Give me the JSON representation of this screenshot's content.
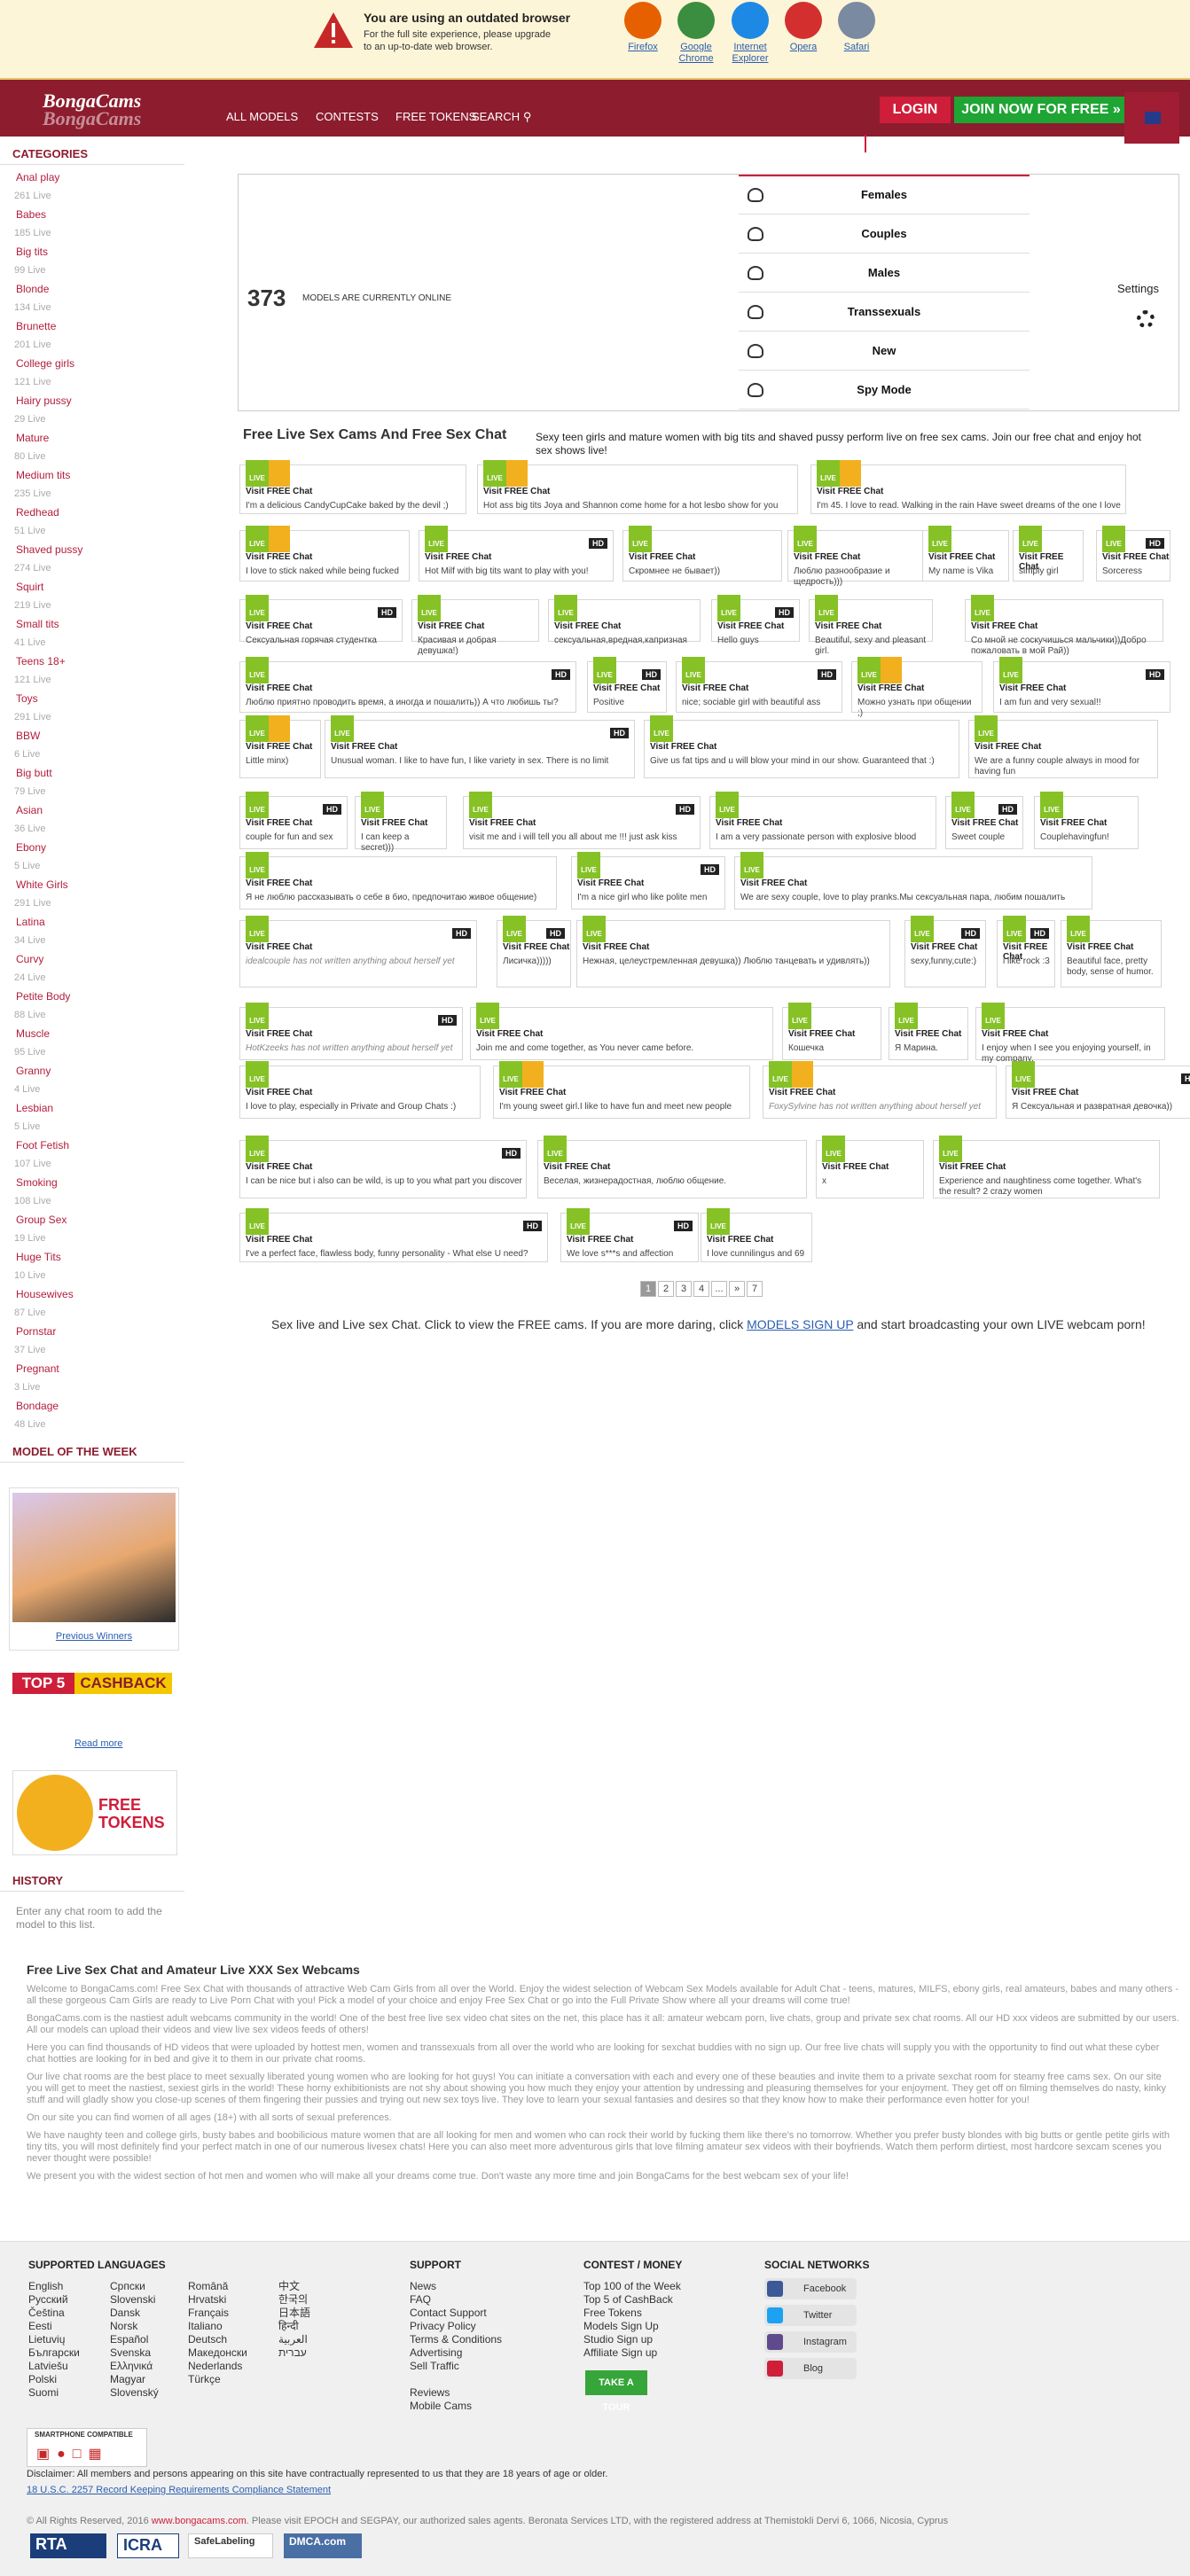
{
  "outdated": {
    "title": "You are using an outdated browser",
    "text": "For the full site experience, please upgrade to an up-to-date web browser.",
    "browsers": [
      {
        "label": "Firefox",
        "icon": "firefox-icon",
        "color": "#e66000"
      },
      {
        "label": "Google Chrome",
        "icon": "chrome-icon",
        "color": "#3b8d3f"
      },
      {
        "label": "Internet Explorer",
        "icon": "ie-icon",
        "color": "#1e88e5"
      },
      {
        "label": "Opera",
        "icon": "opera-icon",
        "color": "#d32f2f"
      },
      {
        "label": "Safari",
        "icon": "safari-icon",
        "color": "#7a8aa0"
      }
    ]
  },
  "header": {
    "logo": "BongaCams",
    "nav": [
      "ALL MODELS",
      "CONTESTS",
      "FREE TOKENS"
    ],
    "search": "SEARCH",
    "login": "LOGIN",
    "join": "JOIN NOW FOR FREE »",
    "brand": "#8c1c2e"
  },
  "sidebar": {
    "categories_title": "CATEGORIES",
    "categories": [
      [
        "Anal play",
        "261 Live"
      ],
      [
        "Babes",
        "185 Live"
      ],
      [
        "Big tits",
        "99 Live"
      ],
      [
        "Blonde",
        "134 Live"
      ],
      [
        "Brunette",
        "201 Live"
      ],
      [
        "College girls",
        "121 Live"
      ],
      [
        "Hairy pussy",
        "29 Live"
      ],
      [
        "Mature",
        "80 Live"
      ],
      [
        "Medium tits",
        "235 Live"
      ],
      [
        "Redhead",
        "51 Live"
      ],
      [
        "Shaved pussy",
        "274 Live"
      ],
      [
        "Squirt",
        "219 Live"
      ],
      [
        "Small tits",
        "41 Live"
      ],
      [
        "Teens 18+",
        "121 Live"
      ],
      [
        "Toys",
        "291 Live"
      ],
      [
        "BBW",
        "6 Live"
      ],
      [
        "Big butt",
        "79 Live"
      ],
      [
        "Asian",
        "36 Live"
      ],
      [
        "Ebony",
        "5 Live"
      ],
      [
        "White Girls",
        "291 Live"
      ],
      [
        "Latina",
        "34 Live"
      ],
      [
        "Curvy",
        "24 Live"
      ],
      [
        "Petite Body",
        "88 Live"
      ],
      [
        "Muscle",
        "95 Live"
      ],
      [
        "Granny",
        "4 Live"
      ],
      [
        "Lesbian",
        "5 Live"
      ],
      [
        "Foot Fetish",
        "107 Live"
      ],
      [
        "Smoking",
        "108 Live"
      ],
      [
        "Group Sex",
        "19 Live"
      ],
      [
        "Huge Tits",
        "10 Live"
      ],
      [
        "Housewives",
        "87 Live"
      ],
      [
        "Pornstar",
        "37 Live"
      ],
      [
        "Pregnant",
        "3 Live"
      ],
      [
        "Bondage",
        "48 Live"
      ]
    ],
    "motw_title": "MODEL OF THE WEEK",
    "previous_winners": "Previous Winners",
    "top5": "TOP 5",
    "cashback": "CASHBACK",
    "read_more": "Read more",
    "free_tokens": "FREE TOKENS",
    "history_title": "HISTORY",
    "history_text": "Enter any chat room to add the model to this list."
  },
  "stats": {
    "count": "373",
    "caption": "MODELS ARE CURRENTLY ONLINE",
    "genders": [
      "Females",
      "Couples",
      "Males",
      "Transsexuals",
      "New",
      "Spy Mode"
    ],
    "settings": "Settings"
  },
  "main": {
    "title": "Free Live Sex Cams And Free Sex Chat",
    "intro": "Sexy teen girls and mature women with big tits and shaved pussy perform live on free sex cams. Join our free chat and enjoy hot sex shows live!",
    "live": "LIVE",
    "visit": "Visit FREE Chat",
    "hd": "HD",
    "cards": [
      [
        "I'm a delicious CandyCupCake baked by the devil ;)",
        0,
        1,
        0
      ],
      [
        "Hot ass big tits Joya and Shannon come home for a hot lesbo show for you",
        0,
        1,
        0
      ],
      [
        "I'm 45. I love to read. Walking in the rain Have sweet dreams of the one I love",
        0,
        1,
        0
      ],
      [
        "I love to stick naked while being fucked",
        0,
        1,
        0
      ],
      [
        "Hot Milf with big tits want to play with you!",
        1,
        0,
        0
      ],
      [
        "Скромнее не бывает))",
        0,
        0,
        0
      ],
      [
        "Люблю разнообразие и щедрость)))",
        0,
        0,
        0
      ],
      [
        "My name is Vika",
        0,
        0,
        0
      ],
      [
        "simply girl",
        0,
        0,
        0
      ],
      [
        "Sorceress",
        1,
        0,
        0
      ],
      [
        "Сексуальная горячая студентка",
        1,
        0,
        0
      ],
      [
        "Красивая и добрая девушка!)",
        0,
        0,
        0
      ],
      [
        "сексуальная,вредная,капризная",
        0,
        0,
        0
      ],
      [
        "Hello guys",
        1,
        0,
        0
      ],
      [
        "Beautiful, sexy and pleasant girl.",
        0,
        0,
        0
      ],
      [
        "Со мной не соскучишься мальчики))Добро пожаловать в мой Рай))",
        0,
        0,
        0
      ],
      [
        "Люблю приятно проводить время, а иногда и пошалить)) А что любишь ты?",
        1,
        0,
        0
      ],
      [
        "Positive",
        1,
        0,
        0
      ],
      [
        "nice; sociable girl with beautiful ass",
        1,
        0,
        0
      ],
      [
        "Можно узнать при общении ;)",
        0,
        1,
        0
      ],
      [
        "I am fun and very sexual!!",
        1,
        0,
        0
      ],
      [
        "Little minx)",
        0,
        1,
        0
      ],
      [
        "Unusual woman. I like to have fun, I like variety in sex. There is no limit",
        1,
        0,
        0
      ],
      [
        "Give us fat tips and u will blow your mind in our show. Guaranteed that :)",
        0,
        0,
        0
      ],
      [
        "We are a funny couple always in mood for having fun",
        0,
        0,
        0
      ],
      [
        "couple for fun and sex",
        1,
        0,
        0
      ],
      [
        "I can keep a secret)))",
        0,
        0,
        0
      ],
      [
        "visit me and i will tell you all about me !!! just ask kiss",
        1,
        0,
        0
      ],
      [
        "I am a very passionate person with explosive blood",
        0,
        0,
        0
      ],
      [
        "Sweet couple",
        1,
        0,
        0
      ],
      [
        "Couplehavingfun!",
        0,
        0,
        0
      ],
      [
        "Я не люблю рассказывать о себе в био, предпочитаю живое общение)",
        0,
        0,
        0
      ],
      [
        "I'm a nice girl who like polite men",
        1,
        0,
        0
      ],
      [
        "We are sexy couple, love to play pranks.Мы сексуальная пара, любим пошалить",
        0,
        0,
        0
      ],
      [
        "idealcouple has not written anything about herself yet",
        1,
        0,
        1
      ],
      [
        "Лисичка)))))",
        1,
        0,
        0
      ],
      [
        "Нежная, целеустремленная девушка)) Люблю танцевать и удивлять))",
        0,
        0,
        0
      ],
      [
        "sexy,funny,cute:)",
        1,
        0,
        0
      ],
      [
        "i like rock :3",
        1,
        0,
        0
      ],
      [
        "Beautiful face, pretty body, sense of humor.",
        0,
        0,
        0
      ],
      [
        "HotKzeeks has not written anything about herself yet",
        1,
        0,
        1
      ],
      [
        "Join me and come together, as You never came before.",
        0,
        0,
        0
      ],
      [
        "Кошечка",
        0,
        0,
        0
      ],
      [
        "Я Марина.",
        0,
        0,
        0
      ],
      [
        "I enjoy when I see you enjoying yourself, in my company.",
        0,
        0,
        0
      ],
      [
        "I love to play, especially in Private and Group Chats :)",
        0,
        0,
        0
      ],
      [
        "I'm young sweet girl.I like to have fun and meet new people",
        0,
        1,
        0
      ],
      [
        "FoxySylvine has not written anything about herself yet",
        0,
        1,
        1
      ],
      [
        "Я Сексуальная и развратная девочка))",
        1,
        0,
        0
      ],
      [
        "I can be nice but i also can be wild, is up to you what part you discover",
        1,
        0,
        0
      ],
      [
        "Веселая, жизнерадостная, люблю общение.",
        0,
        0,
        0
      ],
      [
        "x",
        0,
        0,
        0
      ],
      [
        "Experience and naughtiness come together. What's the result? 2 crazy women",
        0,
        0,
        0
      ],
      [
        "I've a perfect face, flawless body, funny personality - What else U need?",
        1,
        0,
        0
      ],
      [
        "We love s***s and affection",
        1,
        0,
        0
      ],
      [
        "I love cunnilingus and 69",
        0,
        0,
        0
      ]
    ],
    "pages": [
      "1",
      "2",
      "3",
      "4",
      "...",
      "»",
      "7"
    ],
    "cta_pre": "Sex live and Live sex Chat. Click to view the FREE cams. If you are more daring, click ",
    "cta_link": "MODELS SIGN UP",
    "cta_post": " and start broadcasting your own LIVE webcam porn!"
  },
  "seo": {
    "title": "Free Live Sex Chat and Amateur Live XXX Sex Webcams",
    "paras": [
      "Welcome to BongaCams.com! Free Sex Chat with thousands of attractive Web Cam Girls from all over the World. Enjoy the widest selection of Webcam Sex Models available for Adult Chat - teens, matures, MILFS, ebony girls, real amateurs, babes and many others - all these gorgeous Cam Girls are ready to Live Porn Chat with you! Pick a model of your choice and enjoy Free Sex Chat or go into the Full Private Show where all your dreams will come true!",
      "BongaCams.com is the nastiest adult webcams community in the world! One of the best free live sex video chat sites on the net, this place has it all: amateur webcam porn, live chats, group and private sex chat rooms. All our HD xxx videos are submitted by our users. All our models can upload their videos and view live sex videos feeds of others!",
      "Here you can find thousands of HD videos that were uploaded by hottest men, women and transsexuals from all over the world who are looking for sexchat buddies with no sign up. Our free live chats will supply you with the opportunity to find out what these cyber chat hotties are looking for in bed and give it to them in our private chat rooms.",
      "Our live chat rooms are the best place to meet sexually liberated young women who are looking for hot guys! You can initiate a conversation with each and every one of these beauties and invite them to a private sexchat room for steamy free cams sex. On our site you will get to meet the nastiest, sexiest girls in the world! These horny exhibitionists are not shy about showing you how much they enjoy your attention by undressing and pleasuring themselves for your enjoyment. They get off on filming themselves do nasty, kinky stuff and will gladly show you close-up scenes of them fingering their pussies and trying out new sex toys live. They love to learn your sexual fantasies and desires so that they know how to make their performance even hotter for you!",
      "On our site you can find women of all ages (18+) with all sorts of sexual preferences.",
      "We have naughty teen and college girls, busty babes and boobilicious mature women that are all looking for men and women who can rock their world by fucking them like there's no tomorrow. Whether you prefer busty blondes with big butts or gentle petite girls with tiny tits, you will most definitely find your perfect match in one of our numerous livesex chats! Here you can also meet more adventurous girls that love filming amateur sex videos with their boyfriends. Watch them perform dirtiest, most hardcore sexcam scenes you never thought were possible!",
      "We present you with the widest section of hot men and women who will make all your dreams come true. Don't waste any more time and join BongaCams for the best webcam sex of your life!"
    ]
  },
  "footer": {
    "lang_title": "SUPPORTED LANGUAGES",
    "langs": [
      [
        "English",
        "Русский",
        "Čeština",
        "Eesti",
        "Lietuvių",
        "Български",
        "Latviešu",
        "Polski",
        "Suomi"
      ],
      [
        "Српски",
        "Slovenski",
        "Dansk",
        "Norsk",
        "Español",
        "Svenska",
        "Ελληνικά",
        "Magyar",
        "Slovenský"
      ],
      [
        "Română",
        "Hrvatski",
        "Français",
        "Italiano",
        "Deutsch",
        "Македонски",
        "Nederlands",
        "Türkçe"
      ],
      [
        "中文",
        "한국의",
        "日本語",
        "हिन्दी",
        "العربية",
        "עברית"
      ]
    ],
    "support_title": "SUPPORT",
    "support": [
      "News",
      "FAQ",
      "Contact Support",
      "Privacy Policy",
      "Terms & Conditions",
      "Advertising",
      "Sell Traffic",
      "",
      "Reviews",
      "Mobile Cams"
    ],
    "contest_title": "CONTEST / MONEY",
    "contest": [
      "Top 100 of the Week",
      "Top 5 of CashBack",
      "Free Tokens",
      "Models Sign Up",
      "Studio Sign up",
      "Affiliate Sign up"
    ],
    "tour": "TAKE A TOUR",
    "social_title": "SOCIAL NETWORKS",
    "social": [
      {
        "label": "Facebook",
        "color": "#3b5998",
        "icon": "facebook-icon"
      },
      {
        "label": "Twitter",
        "color": "#1da1f2",
        "icon": "twitter-icon"
      },
      {
        "label": "Instagram",
        "color": "#5f4b8b",
        "icon": "instagram-icon"
      },
      {
        "label": "Blog",
        "color": "#cf1e3a",
        "icon": "blog-icon"
      }
    ],
    "smart": "SMARTPHONE COMPATIBLE",
    "disclaimer": "Disclaimer: All members and persons appearing on this site have contractually represented to us that they are 18 years of age or older.",
    "usc": "18 U.S.C. 2257 Record Keeping Requirements Compliance Statement",
    "copy1": "© All Rights Reserved, 2016 ",
    "copy_link": "www.bongacams.com",
    "copy2": ". Please visit EPOCH and SEGPAY, our authorized sales agents. Beronata Services LTD, with the registered address at Themistokli Dervi 6, 1066, Nicosia, Cyprus",
    "badges": [
      "RTA",
      "ICRA",
      "SafeLabeling",
      "DMCA.com"
    ]
  }
}
